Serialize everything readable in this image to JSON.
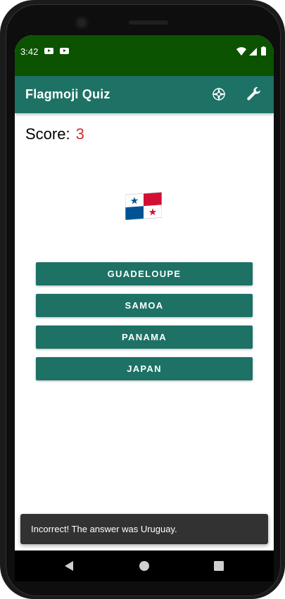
{
  "status_bar": {
    "time": "3:42",
    "background": "#0b5300",
    "notification_icons": [
      "youtube-icon",
      "youtube-icon"
    ],
    "right_icons": [
      "wifi-icon",
      "signal-icon",
      "battery-icon"
    ]
  },
  "app_bar": {
    "title": "Flagmoji Quiz",
    "background": "#1d7165",
    "actions": [
      {
        "name": "compass-icon"
      },
      {
        "name": "wrench-icon"
      }
    ]
  },
  "score": {
    "label": "Score:",
    "value": "3",
    "value_color": "#d32f2f"
  },
  "question": {
    "flag": "panama-flag"
  },
  "answers": [
    {
      "label": "GUADELOUPE"
    },
    {
      "label": "SAMOA"
    },
    {
      "label": "PANAMA"
    },
    {
      "label": "JAPAN"
    }
  ],
  "snackbar": {
    "text": "Incorrect! The answer was Uruguay."
  },
  "nav": {
    "buttons": [
      "back-icon",
      "home-icon",
      "recents-icon"
    ]
  },
  "colors": {
    "accent": "#1d7165",
    "status": "#0b5300",
    "score": "#d32f2f"
  }
}
